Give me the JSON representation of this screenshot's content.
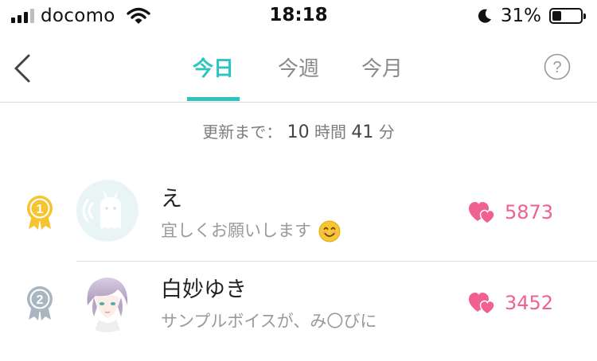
{
  "status_bar": {
    "carrier": "docomo",
    "time": "18:18",
    "battery_percent": "31%",
    "battery_level": 0.31,
    "signal_bars_filled": 3,
    "signal_bars_total": 4
  },
  "nav": {
    "tabs": [
      {
        "label": "今日",
        "active": true
      },
      {
        "label": "今週",
        "active": false
      },
      {
        "label": "今月",
        "active": false
      }
    ],
    "help_label": "?"
  },
  "countdown": {
    "prefix": "更新まで：",
    "hours": "10",
    "hours_unit": "時間",
    "minutes": "41",
    "minutes_unit": "分"
  },
  "ranking": [
    {
      "rank": "1",
      "name": "え",
      "message": "宜しくお願いします",
      "likes": "5873",
      "medal_color": "#f5c431",
      "avatar": "default-character"
    },
    {
      "rank": "2",
      "name": "白妙ゆき",
      "message": "サンプルボイスが、み〇びに",
      "likes": "3452",
      "medal_color": "#a9b6c2",
      "avatar": "user-portrait"
    }
  ],
  "colors": {
    "accent": "#2ec4c0",
    "likes": "#f06090",
    "heart": "#f06090"
  }
}
